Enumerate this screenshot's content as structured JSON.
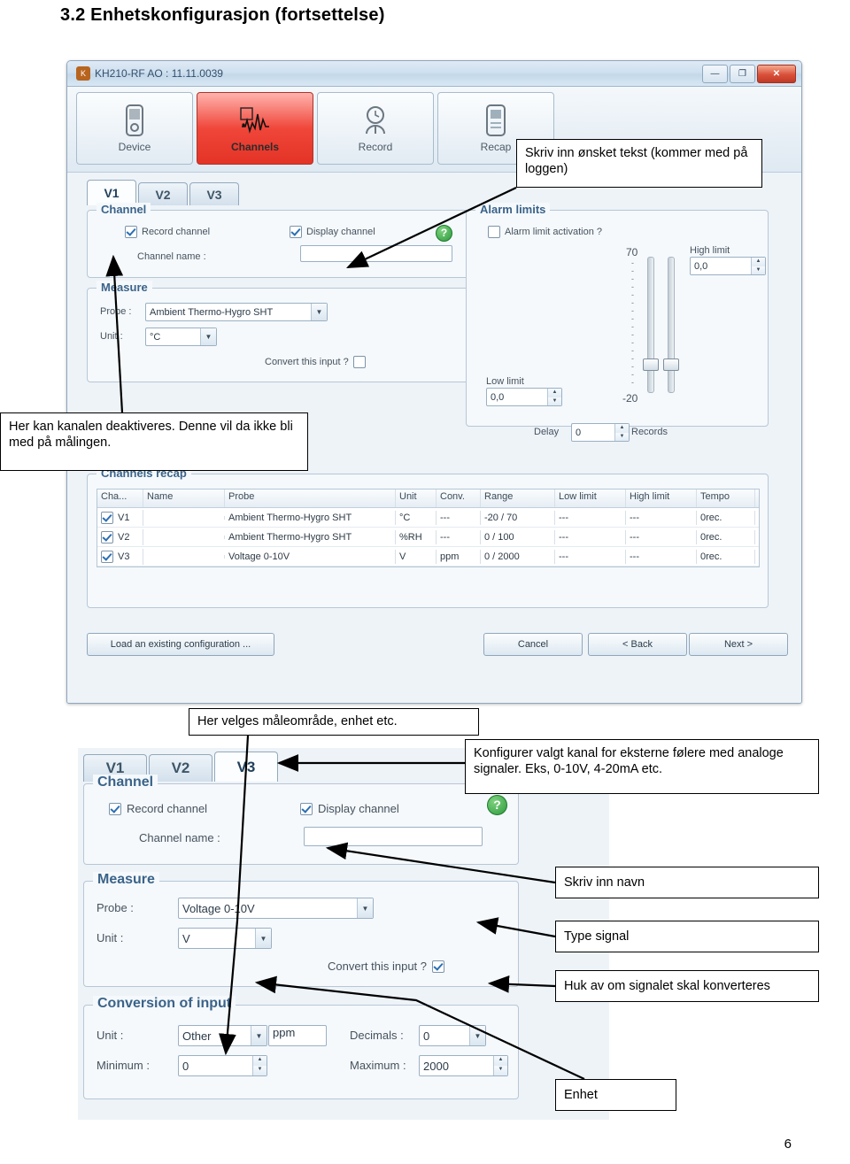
{
  "document": {
    "heading": "3.2 Enhetskonfigurasjon (fortsettelse)",
    "page_number": "6"
  },
  "annotations": [
    {
      "id": "note-text-log",
      "text": "Skriv inn ønsket tekst (kommer med på loggen)"
    },
    {
      "id": "note-deactivate",
      "text": "Her kan kanalen deaktiveres. Denne vil da ikke bli med på målingen."
    },
    {
      "id": "note-range",
      "text": "Her velges måleområde, enhet etc."
    },
    {
      "id": "note-configure",
      "text": "Konfigurer valgt kanal for eksterne følere med analoge signaler. Eks, 0-10V, 4-20mA etc."
    },
    {
      "id": "note-name",
      "text": "Skriv inn navn"
    },
    {
      "id": "note-signal-type",
      "text": "Type signal"
    },
    {
      "id": "note-convert",
      "text": "Huk av om signalet skal konverteres"
    },
    {
      "id": "note-unit",
      "text": "Enhet"
    }
  ],
  "app_window": {
    "title": "KH210-RF AO : 11.11.0039",
    "window_buttons": {
      "minimize": "—",
      "maximize": "❐",
      "close": "✕"
    },
    "toolbar": [
      {
        "label": "Device",
        "icon": "device-icon",
        "active": false
      },
      {
        "label": "Channels",
        "icon": "waveform-icon",
        "active": true
      },
      {
        "label": "Record",
        "icon": "clock-icon",
        "active": false
      },
      {
        "label": "Recap",
        "icon": "recap-icon",
        "active": false
      }
    ],
    "tabs": [
      {
        "label": "V1",
        "selected": true
      },
      {
        "label": "V2",
        "selected": false
      },
      {
        "label": "V3",
        "selected": false
      }
    ],
    "channel_group": {
      "legend": "Channel",
      "record_channel": {
        "label": "Record channel",
        "checked": true
      },
      "display_channel": {
        "label": "Display channel",
        "checked": true
      },
      "channel_name": {
        "label": "Channel name :",
        "value": ""
      }
    },
    "measure_group": {
      "legend": "Measure",
      "probe": {
        "label": "Probe :",
        "value": "Ambient Thermo-Hygro SHT"
      },
      "unit": {
        "label": "Unit :",
        "value": "°C"
      },
      "convert": {
        "label": "Convert this input ?",
        "checked": false
      }
    },
    "alarm_group": {
      "legend": "Alarm limits",
      "activation": {
        "label": "Alarm limit activation ?",
        "checked": false
      },
      "high_limit": {
        "label": "High limit",
        "value": "0,0"
      },
      "low_limit": {
        "label": "Low limit",
        "value": "0,0"
      },
      "scale_top": "70",
      "scale_bottom": "-20",
      "delay": {
        "label": "Delay",
        "value": "0",
        "suffix": "Records"
      }
    },
    "recap": {
      "legend": "Channels recap",
      "columns": [
        "Cha...",
        "Name",
        "Probe",
        "Unit",
        "Conv.",
        "Range",
        "Low limit",
        "High limit",
        "Tempo"
      ],
      "rows": [
        {
          "checked": true,
          "channel": "V1",
          "name": "",
          "probe": "Ambient Thermo-Hygro SHT",
          "unit": "°C",
          "conv": "---",
          "range": "-20 / 70",
          "low": "---",
          "high": "---",
          "tempo": "0rec."
        },
        {
          "checked": true,
          "channel": "V2",
          "name": "",
          "probe": "Ambient Thermo-Hygro SHT",
          "unit": "%RH",
          "conv": "---",
          "range": "0 / 100",
          "low": "---",
          "high": "---",
          "tempo": "0rec."
        },
        {
          "checked": true,
          "channel": "V3",
          "name": "",
          "probe": "Voltage 0-10V",
          "unit": "V",
          "conv": "ppm",
          "range": "0 / 2000",
          "low": "---",
          "high": "---",
          "tempo": "0rec."
        }
      ]
    },
    "footer_buttons": {
      "load": "Load an existing configuration ...",
      "cancel": "Cancel",
      "back": "< Back",
      "next": "Next >"
    }
  },
  "app_window2": {
    "tabs": [
      {
        "label": "V1",
        "selected": false
      },
      {
        "label": "V2",
        "selected": false
      },
      {
        "label": "V3",
        "selected": true
      }
    ],
    "channel_group": {
      "legend": "Channel",
      "record_channel": {
        "label": "Record channel",
        "checked": true
      },
      "display_channel": {
        "label": "Display channel",
        "checked": true
      },
      "channel_name": {
        "label": "Channel name :",
        "value": ""
      }
    },
    "measure_group": {
      "legend": "Measure",
      "probe": {
        "label": "Probe :",
        "value": "Voltage 0-10V"
      },
      "unit": {
        "label": "Unit :",
        "value": "V"
      },
      "convert": {
        "label": "Convert this input ?",
        "checked": true
      }
    },
    "conversion_group": {
      "legend": "Conversion of input",
      "unit": {
        "label": "Unit :",
        "value": "Other",
        "suffix": "ppm"
      },
      "decimals": {
        "label": "Decimals :",
        "value": "0"
      },
      "minimum": {
        "label": "Minimum :",
        "value": "0"
      },
      "maximum": {
        "label": "Maximum :",
        "value": "2000"
      }
    }
  }
}
